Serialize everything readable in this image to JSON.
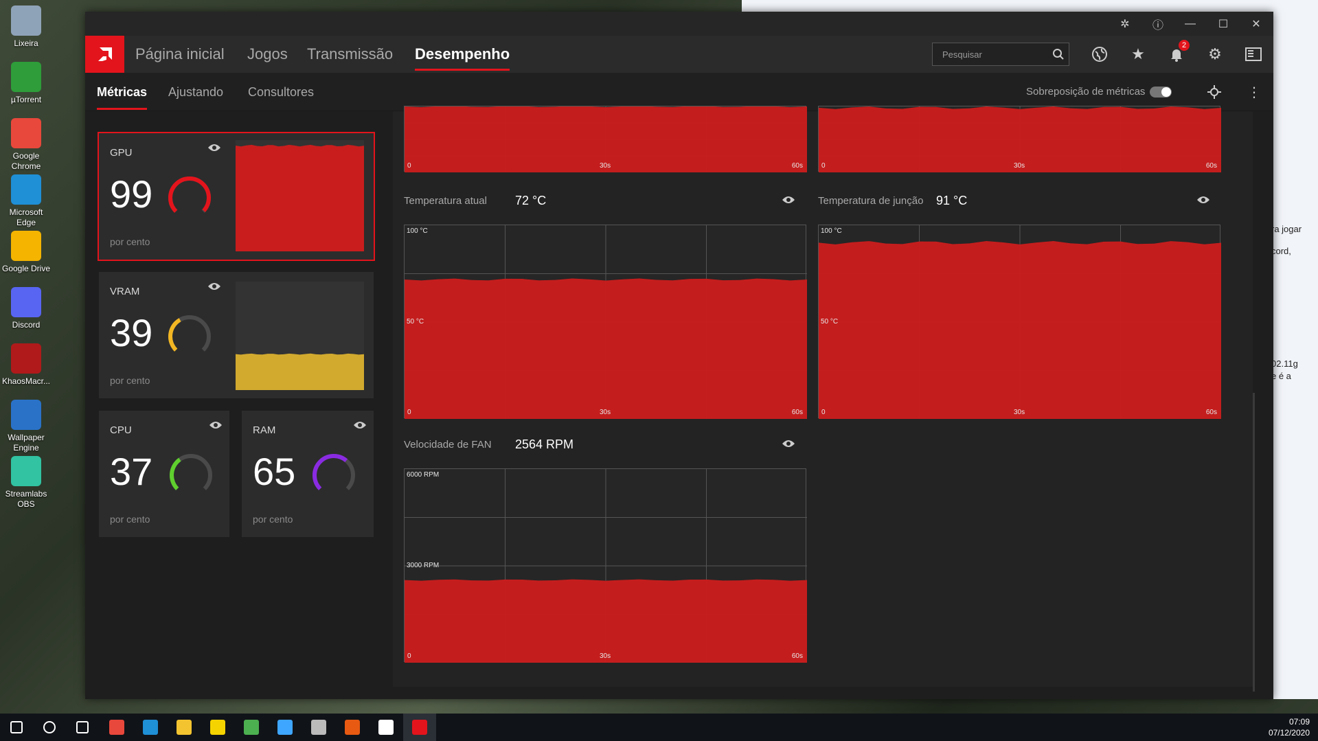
{
  "desktop": {
    "icons": [
      {
        "label": "Lixeira",
        "icon": "recycle-bin-icon",
        "color": "#8fa3b8"
      },
      {
        "label": "µTorrent",
        "icon": "utorrent-icon",
        "color": "#2e9d3a"
      },
      {
        "label": "Google Chrome",
        "icon": "chrome-icon",
        "color": "#e8483b"
      },
      {
        "label": "Microsoft Edge",
        "icon": "edge-icon",
        "color": "#1f8fd6"
      },
      {
        "label": "Google Drive",
        "icon": "google-drive-icon",
        "color": "#f4b400"
      },
      {
        "label": "Discord",
        "icon": "discord-icon",
        "color": "#5865f2"
      },
      {
        "label": "KhaosMacr...",
        "icon": "khaos-icon",
        "color": "#b01a1a"
      },
      {
        "label": "Wallpaper Engine",
        "icon": "wallpaper-engine-icon",
        "color": "#2a72c8"
      },
      {
        "label": "Streamlabs OBS",
        "icon": "streamlabs-icon",
        "color": "#31c3a2"
      }
    ],
    "background_window_text": [
      "ra jogar",
      "cord,",
      "02.11g",
      "e é a"
    ]
  },
  "app": {
    "accent": "#e3141c",
    "nav": {
      "items": [
        {
          "label": "Página inicial",
          "active": false
        },
        {
          "label": "Jogos",
          "active": false
        },
        {
          "label": "Transmissão",
          "active": false
        },
        {
          "label": "Desempenho",
          "active": true
        }
      ],
      "search_placeholder": "Pesquisar",
      "notification_count": "2"
    },
    "subnav": {
      "items": [
        {
          "label": "Métricas",
          "active": true
        },
        {
          "label": "Ajustando",
          "active": false
        },
        {
          "label": "Consultores",
          "active": false
        }
      ],
      "overlay_label": "Sobreposição de métricas",
      "overlay_enabled": false
    },
    "cards": {
      "gpu": {
        "title": "GPU",
        "value": "99",
        "unit": "por cento",
        "percent": 99,
        "color": "#e3141c"
      },
      "vram": {
        "title": "VRAM",
        "value": "39",
        "unit": "por cento",
        "percent": 39,
        "color": "#f2b623"
      },
      "cpu": {
        "title": "CPU",
        "value": "37",
        "unit": "por cento",
        "percent": 37,
        "color": "#5fcf2e"
      },
      "ram": {
        "title": "RAM",
        "value": "65",
        "unit": "por cento",
        "percent": 65,
        "color": "#8a2be2"
      }
    },
    "metrics": {
      "temp_current": {
        "label": "Temperatura atual",
        "value": "72 °C",
        "ymax_label": "100 °C",
        "ymid_label": "50 °C",
        "level": 72
      },
      "temp_junction": {
        "label": "Temperatura de junção",
        "value": "91 °C",
        "ymax_label": "100 °C",
        "ymid_label": "50 °C",
        "level": 91
      },
      "fan_speed": {
        "label": "Velocidade de FAN",
        "value": "2564 RPM",
        "ymax_label": "6000 RPM",
        "ymid_label": "3000 RPM",
        "level": 42.7
      },
      "x_labels": [
        "0",
        "30s",
        "60s"
      ]
    }
  },
  "taskbar": {
    "apps": [
      {
        "icon": "start-icon",
        "color": "#ffffff"
      },
      {
        "icon": "cortana-icon",
        "color": "#ffffff"
      },
      {
        "icon": "task-view-icon",
        "color": "#ffffff"
      },
      {
        "icon": "chrome-icon",
        "color": "#e8483b"
      },
      {
        "icon": "edge-icon",
        "color": "#1f8fd6"
      },
      {
        "icon": "file-explorer-icon",
        "color": "#f4c430"
      },
      {
        "icon": "sticky-notes-icon",
        "color": "#f5d300"
      },
      {
        "icon": "photos-icon",
        "color": "#4caf50"
      },
      {
        "icon": "game-icon",
        "color": "#3ea6ff"
      },
      {
        "icon": "app-icon",
        "color": "#bbbbbb"
      },
      {
        "icon": "black-ops-icon",
        "color": "#e85a12"
      },
      {
        "icon": "shield-icon",
        "color": "#ffffff"
      },
      {
        "icon": "amd-radeon-icon",
        "color": "#e3141c"
      }
    ],
    "time": "07:09",
    "date": "07/12/2020"
  }
}
